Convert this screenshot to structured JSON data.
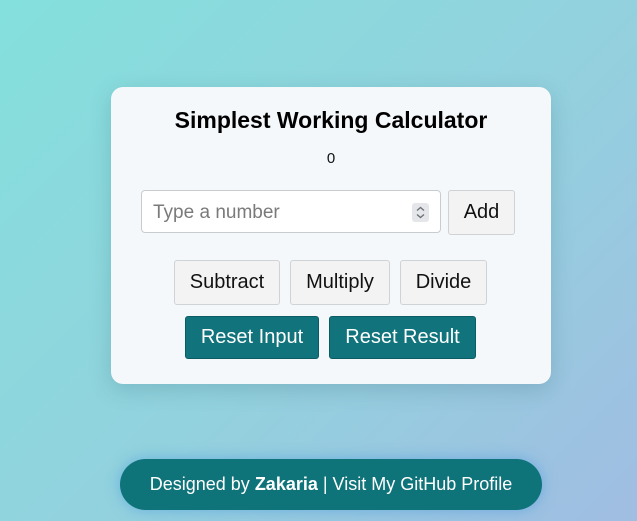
{
  "calculator": {
    "title": "Simplest Working Calculator",
    "result": "0",
    "input": {
      "placeholder": "Type a number",
      "value": ""
    },
    "buttons": {
      "add": "Add",
      "subtract": "Subtract",
      "multiply": "Multiply",
      "divide": "Divide",
      "reset_input": "Reset Input",
      "reset_result": "Reset Result"
    },
    "colors": {
      "primary": "#11747c",
      "card_background": "#f4f8fb"
    }
  },
  "footer": {
    "prefix": "Designed by ",
    "author": "Zakaria",
    "separator": " | ",
    "link_text": "Visit My GitHub Profile"
  }
}
